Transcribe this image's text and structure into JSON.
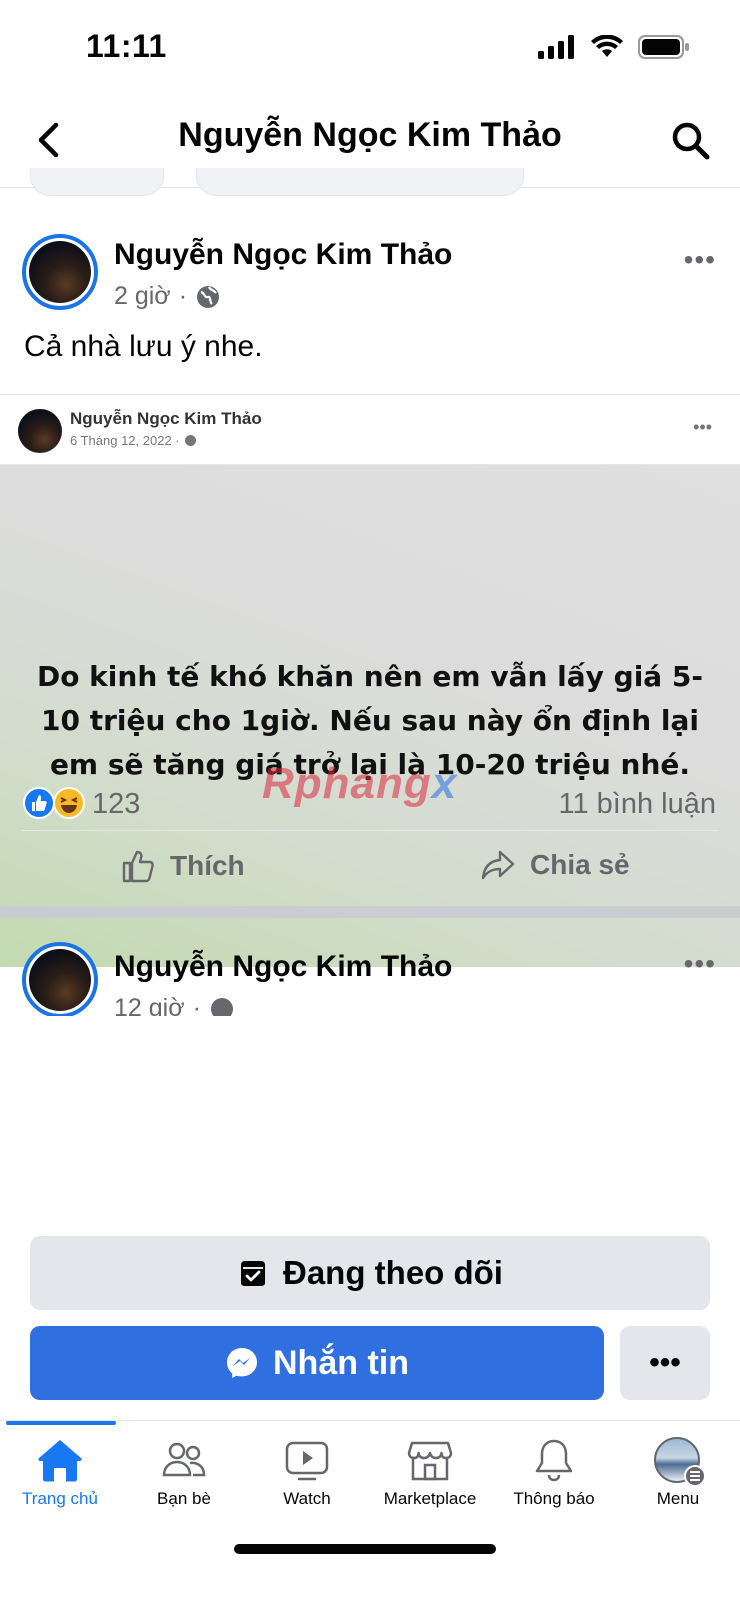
{
  "status_bar": {
    "time": "11:11"
  },
  "header": {
    "title": "Nguyễn Ngọc Kim Thảo"
  },
  "post": {
    "author": "Nguyễn Ngọc Kim Thảo",
    "time": "2 giờ",
    "meta_sep": "·",
    "text": "Cả nhà lưu ý nhe.",
    "more": "•••",
    "shared": {
      "author": "Nguyễn Ngọc Kim Thảo",
      "date": "6 Tháng 12, 2022 ·",
      "more": "•••",
      "body_lines": [
        "Do kinh tế khó khăn nên em vẫn lấy giá 5-",
        "10 triệu cho 1giờ. Nếu sau này ổn định lại",
        "em sẽ tăng giá trở lại là 10-20 triệu nhé."
      ],
      "watermark_a": "Rphang",
      "watermark_b": "x"
    },
    "reaction_count": "123",
    "comment_count": "11 bình luận",
    "like_label": "Thích",
    "share_label": "Chia sẻ"
  },
  "post2": {
    "author": "Nguyễn Ngọc Kim Thảo",
    "time": "12 giờ",
    "meta_sep": "·",
    "more": "•••"
  },
  "actions": {
    "following_label": "Đang theo dõi",
    "message_label": "Nhắn tin",
    "more_label": "•••"
  },
  "tabs": [
    {
      "label": "Trang chủ",
      "icon": "home-icon",
      "active": true
    },
    {
      "label": "Bạn bè",
      "icon": "friends-icon",
      "active": false
    },
    {
      "label": "Watch",
      "icon": "watch-icon",
      "active": false
    },
    {
      "label": "Marketplace",
      "icon": "marketplace-icon",
      "active": false
    },
    {
      "label": "Thông báo",
      "icon": "bell-icon",
      "active": false
    },
    {
      "label": "Menu",
      "icon": "menu-avatar-icon",
      "active": false
    }
  ],
  "colors": {
    "accent": "#1877f2",
    "messenger": "#2f6fe0",
    "muted": "#65676b"
  }
}
